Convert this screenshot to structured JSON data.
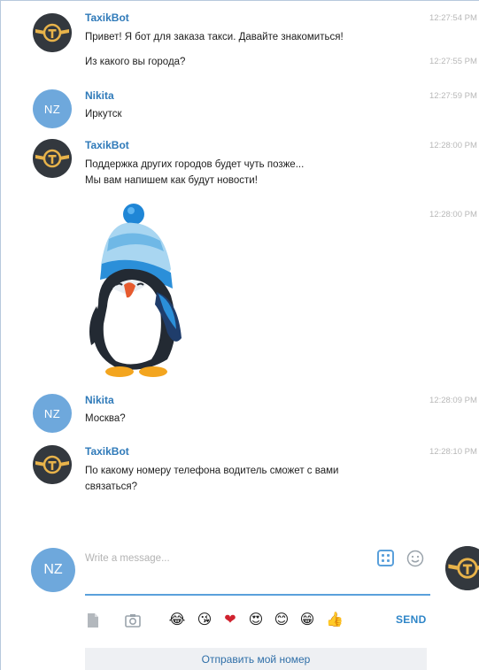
{
  "messages": [
    {
      "kind": "bot",
      "author": "TaxikBot",
      "lines": [
        "Привет! Я бот для заказа такси. Давайте знакомиться!"
      ],
      "time": "12:27:54 PM"
    },
    {
      "kind": "bot-cont",
      "lines": [
        "Из какого вы города?"
      ],
      "time": "12:27:55 PM"
    },
    {
      "kind": "user",
      "author": "Nikita",
      "avatar": "NZ",
      "lines": [
        "Иркутск"
      ],
      "time": "12:27:59 PM"
    },
    {
      "kind": "bot",
      "author": "TaxikBot",
      "lines": [
        "Поддержка других городов будет чуть позже...",
        "Мы вам напишем как будут новости!"
      ],
      "time": "12:28:00 PM"
    },
    {
      "kind": "sticker",
      "time": "12:28:00 PM"
    },
    {
      "kind": "user",
      "author": "Nikita",
      "avatar": "NZ",
      "lines": [
        "Москва?"
      ],
      "time": "12:28:09 PM"
    },
    {
      "kind": "bot",
      "author": "TaxikBot",
      "lines": [
        "По какому номеру телефона водитель сможет с вами",
        "связаться?"
      ],
      "time": "12:28:10 PM"
    }
  ],
  "compose": {
    "avatar": "NZ",
    "placeholder": "Write a message...",
    "send_label": "SEND"
  },
  "toolbar": {
    "icons": [
      "file-icon",
      "camera-icon"
    ],
    "emojis": [
      "😂",
      "😘",
      "❤",
      "😍",
      "😊",
      "😁",
      "👍"
    ]
  },
  "reply_keyboard": {
    "button_label": "Отправить мой номер"
  },
  "colors": {
    "accent": "#2f86c8",
    "user_avatar": "#6ea8dc",
    "bot_avatar": "#33383e",
    "author_name": "#2f7ab9"
  }
}
